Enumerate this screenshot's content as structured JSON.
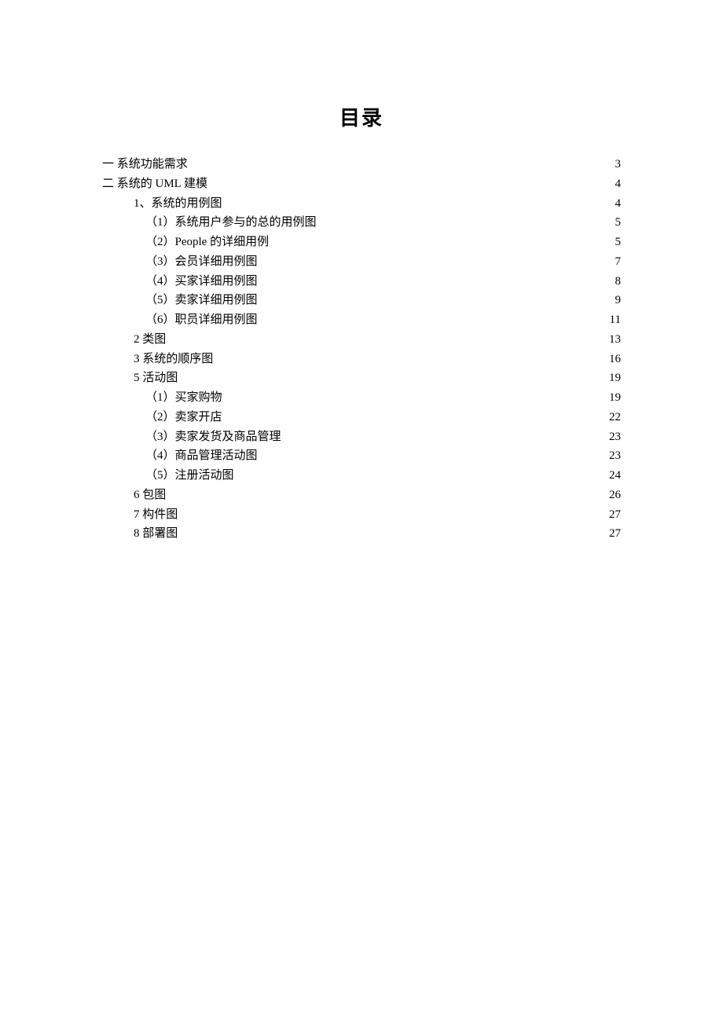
{
  "title": "目录",
  "entries": [
    {
      "label": "一  系统功能需求",
      "page": "3",
      "level": 1
    },
    {
      "label": "二  系统的 UML 建模",
      "page": "4",
      "level": 1
    },
    {
      "label": "1、系统的用例图",
      "page": "4",
      "level": 2
    },
    {
      "label": "（1）系统用户参与的总的用例图 ",
      "page": "5",
      "level": 3
    },
    {
      "label": "（2）People 的详细用例 ",
      "page": "5",
      "level": 3
    },
    {
      "label": "（3）会员详细用例图 ",
      "page": "7",
      "level": 3
    },
    {
      "label": "（4）买家详细用例图 ",
      "page": "8",
      "level": 3
    },
    {
      "label": "（5）卖家详细用例图 ",
      "page": "9",
      "level": 3
    },
    {
      "label": "（6）职员详细用例图 ",
      "page": "11",
      "level": 3
    },
    {
      "label": "2 类图",
      "page": "13",
      "level": 2
    },
    {
      "label": "3  系统的顺序图",
      "page": "16",
      "level": 2
    },
    {
      "label": "5 活动图",
      "page": "19",
      "level": 2
    },
    {
      "label": "（1）买家购物 ",
      "page": "19",
      "level": 3
    },
    {
      "label": "（2）卖家开店 ",
      "page": "22",
      "level": 3
    },
    {
      "label": "（3）卖家发货及商品管理 ",
      "page": "23",
      "level": 3
    },
    {
      "label": "（4）商品管理活动图 ",
      "page": "23",
      "level": 3
    },
    {
      "label": "（5）注册活动图 ",
      "page": "24",
      "level": 3
    },
    {
      "label": "6 包图",
      "page": "26",
      "level": 2
    },
    {
      "label": "7 构件图",
      "page": "27",
      "level": 2
    },
    {
      "label": "8 部署图",
      "page": "27",
      "level": 2
    }
  ]
}
